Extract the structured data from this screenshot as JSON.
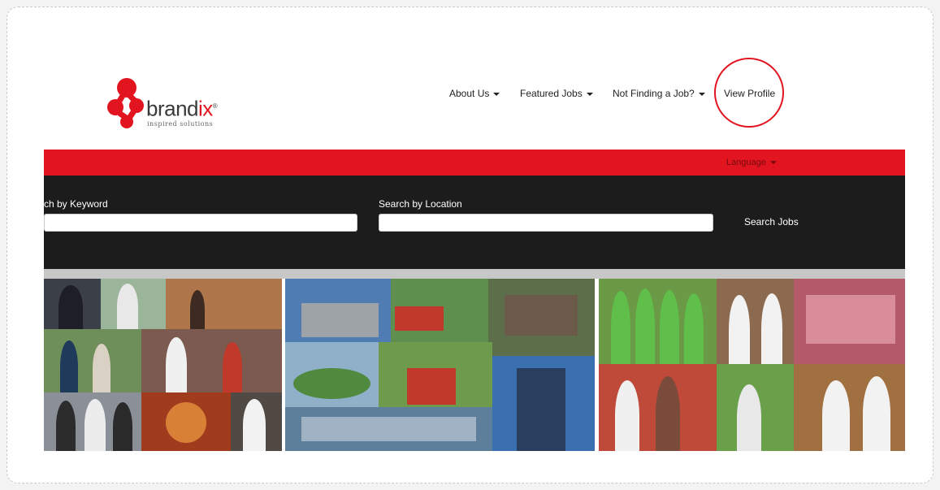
{
  "logo": {
    "wordmark_main": "brand",
    "wordmark_accent": "ix",
    "registered": "®",
    "tagline": "inspired solutions"
  },
  "nav": {
    "items": [
      {
        "label": "About Us"
      },
      {
        "label": "Featured Jobs"
      },
      {
        "label": "Not Finding a Job?"
      }
    ],
    "view_profile": "View Profile"
  },
  "language": {
    "label": "Language"
  },
  "search": {
    "keyword_label": "ch by Keyword",
    "keyword_value": "",
    "location_label": "Search by Location",
    "location_value": "",
    "button_label": "Search Jobs"
  },
  "colors": {
    "brand_red": "#e2141f",
    "dark_bar": "#1c1c1c",
    "separator": "#c7c7c7",
    "highlight_circle": "#e2141f"
  },
  "collage": {
    "panels": [
      "people-at-work",
      "facilities-and-buildings",
      "community-and-schools"
    ]
  }
}
